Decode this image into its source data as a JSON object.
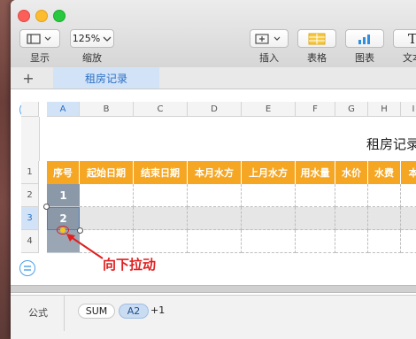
{
  "toolbar": {
    "view_label": "显示",
    "zoom_value": "125%",
    "zoom_label": "缩放",
    "insert_label": "插入",
    "table_label": "表格",
    "chart_label": "图表",
    "text_label": "文本",
    "text_icon_glyph": "T"
  },
  "tabs": {
    "add_glyph": "+",
    "sheet_name": "租房记录"
  },
  "columns": [
    "A",
    "B",
    "C",
    "D",
    "E",
    "F",
    "G",
    "H",
    "I"
  ],
  "rows": [
    "1",
    "2",
    "3",
    "4"
  ],
  "table": {
    "title": "租房记录",
    "headers": [
      "序号",
      "起始日期",
      "结束日期",
      "本月水方",
      "上月水方",
      "用水量",
      "水价",
      "水费",
      "本"
    ],
    "seq_values": [
      "1",
      "2"
    ]
  },
  "annotation": {
    "text": "向下拉动",
    "color": "#e02020"
  },
  "formula": {
    "label": "公式",
    "func": "SUM",
    "ref": "A2",
    "tail": "+1"
  },
  "colors": {
    "header_orange": "#f5a623",
    "selected_gray": "#8a98a8",
    "accent_blue": "#2a6fc4"
  }
}
